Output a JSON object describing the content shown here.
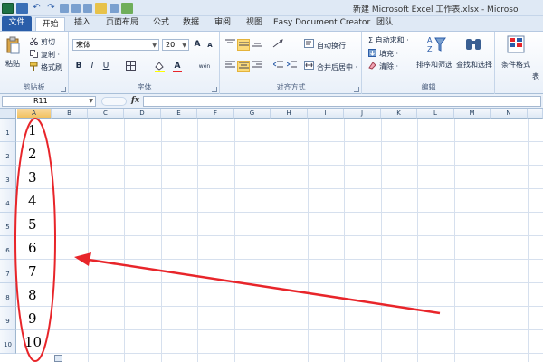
{
  "window": {
    "title": "新建 Microsoft Excel 工作表.xlsx - Microso"
  },
  "quick_access": {
    "icons": [
      "excel-app-icon",
      "save-icon",
      "undo-icon",
      "redo-icon",
      "toolbar-icon",
      "toolbar-icon",
      "toolbar-icon",
      "toolbar-icon",
      "toolbar-icon",
      "toolbar-icon"
    ]
  },
  "tabs": [
    {
      "label": "文件"
    },
    {
      "label": "开始"
    },
    {
      "label": "插入"
    },
    {
      "label": "页面布局"
    },
    {
      "label": "公式"
    },
    {
      "label": "数据"
    },
    {
      "label": "审阅"
    },
    {
      "label": "视图"
    },
    {
      "label": "Easy Document Creator"
    },
    {
      "label": "团队"
    }
  ],
  "ribbon": {
    "clipboard": {
      "paste": "粘贴",
      "cut": "剪切",
      "copy": "复制 ·",
      "format_painter": "格式刷",
      "group_label": "剪贴板"
    },
    "font": {
      "font_name": "宋体",
      "font_size": "20",
      "grow": "A",
      "shrink": "A",
      "bold": "B",
      "italic": "I",
      "underline": "U",
      "font_color_glyph": "A",
      "phonetic": "wén",
      "group_label": "字体"
    },
    "alignment": {
      "wrap_text": "自动换行",
      "merge_center": "合并后居中 ·",
      "group_label": "对齐方式"
    },
    "editing": {
      "autosum": "Σ 自动求和 ·",
      "fill": "填充 ·",
      "clear": "清除 ·",
      "sort_filter": "排序和筛选",
      "find_select": "查找和选择",
      "group_label": "编辑"
    },
    "styles": {
      "conditional_format": "条件格式",
      "format_as_table": "表"
    }
  },
  "formula_bar": {
    "name_box": "R11",
    "fx": "fx",
    "formula": ""
  },
  "sheet": {
    "columns": [
      "A",
      "B",
      "C",
      "D",
      "E",
      "F",
      "G",
      "H",
      "I",
      "J",
      "K",
      "L",
      "M",
      "N"
    ],
    "rows": [
      "1",
      "2",
      "3",
      "4",
      "5",
      "6",
      "7",
      "8",
      "9",
      "10"
    ],
    "column_a_values": [
      "1",
      "2",
      "3",
      "4",
      "5",
      "6",
      "7",
      "8",
      "9",
      "10"
    ]
  },
  "annotation": {
    "color": "#e8252a",
    "shapes": [
      "ellipse",
      "arrow"
    ]
  },
  "colors": {
    "file_tab": "#2a5ea9",
    "ribbon_bg": "#dfe9f5",
    "selected_button": "#fbdb7a",
    "annotation_red": "#e8252a"
  }
}
